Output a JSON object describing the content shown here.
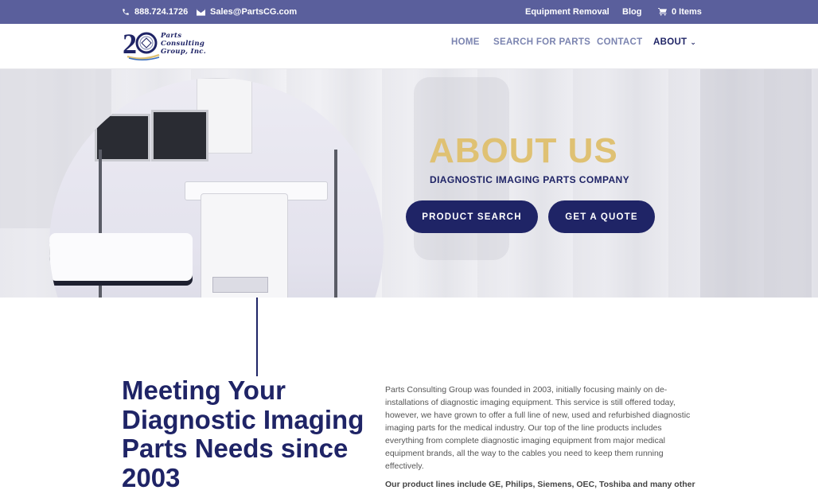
{
  "topbar": {
    "phone": "888.724.1726",
    "email": "Sales@PartsCG.com",
    "equipment_removal": "Equipment Removal",
    "blog": "Blog",
    "cart": "0 Items"
  },
  "logo": {
    "number": "20",
    "line1": "Parts",
    "line2": "Consulting",
    "line3": "Group, Inc."
  },
  "nav": {
    "home": "HOME",
    "search": "SEARCH FOR PARTS",
    "contact": "CONTACT",
    "about": "ABOUT"
  },
  "hero": {
    "title": "ABOUT US",
    "subtitle": "DIAGNOSTIC IMAGING PARTS COMPANY",
    "btn_search": "PRODUCT SEARCH",
    "btn_quote": "GET A QUOTE"
  },
  "content": {
    "heading": "Meeting Your Diagnostic Imaging Parts Needs since 2003",
    "paragraph": "Parts Consulting Group was founded in 2003, initially focusing mainly on de-installations of diagnostic imaging equipment. This service is still offered today, however, we have grown to offer a full line of new, used and refurbished diagnostic imaging parts for the medical industry. Our top of the line products includes everything from complete diagnostic imaging equipment from major medical equipment brands, all the way to the cables you need to keep them running effectively.",
    "paragraph2": "Our product lines include GE, Philips, Siemens, OEC, Toshiba and many other"
  },
  "colors": {
    "topbar": "#5a5f9c",
    "navy": "#1f2466",
    "gold": "#dfc173",
    "nav_link": "#7b84b0"
  },
  "icons": {
    "phone": "phone-icon",
    "email": "envelope-icon",
    "cart": "cart-icon",
    "about_dropdown": "chevron-down-icon"
  }
}
